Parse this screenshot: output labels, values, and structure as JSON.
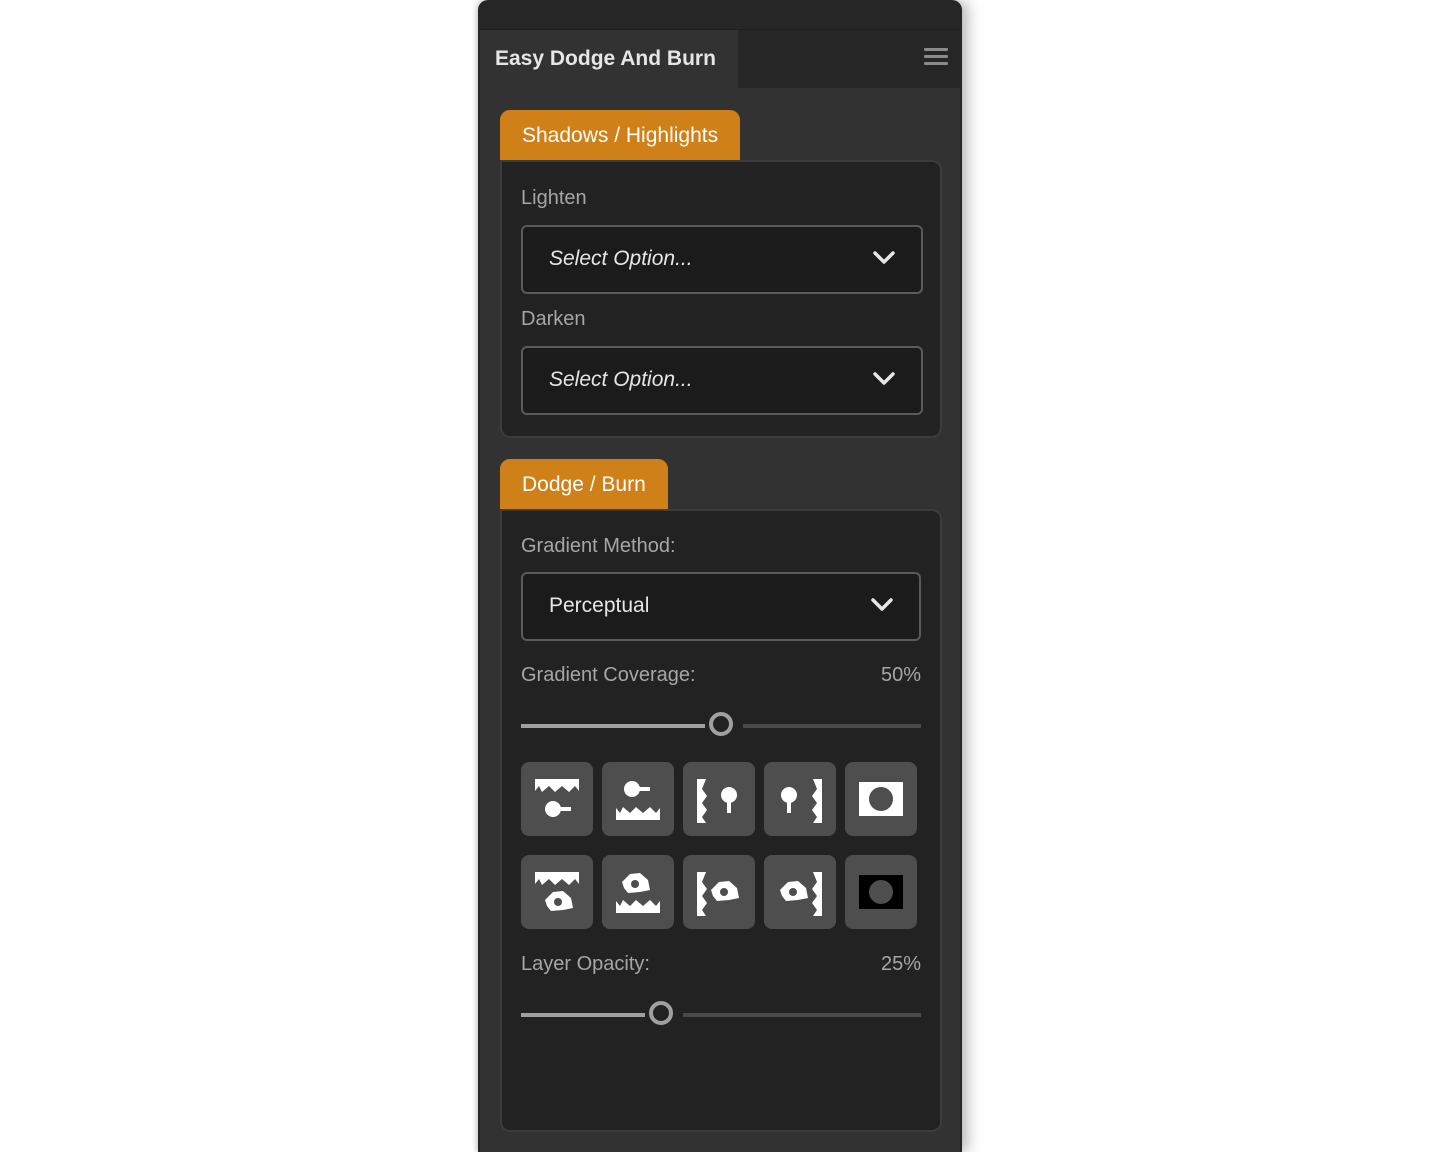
{
  "panel": {
    "title": "Easy Dodge And Burn",
    "menu_icon": "hamburger-menu-icon"
  },
  "shadows_highlights": {
    "tab_label": "Shadows / Highlights",
    "lighten": {
      "label": "Lighten",
      "value": "Select Option..."
    },
    "darken": {
      "label": "Darken",
      "value": "Select Option..."
    }
  },
  "dodge_burn": {
    "tab_label": "Dodge / Burn",
    "gradient_method": {
      "label": "Gradient Method:",
      "value": "Perceptual"
    },
    "gradient_coverage": {
      "label": "Gradient Coverage:",
      "value_text": "50%",
      "slider_fraction": 0.5
    },
    "gradient_buttons": [
      {
        "icon": "gradient-top-to-bottom-highlight-icon"
      },
      {
        "icon": "gradient-bottom-to-top-highlight-icon"
      },
      {
        "icon": "gradient-left-to-right-highlight-icon"
      },
      {
        "icon": "gradient-right-to-left-highlight-icon"
      },
      {
        "icon": "vignette-highlight-icon"
      },
      {
        "icon": "gradient-top-to-bottom-subject-icon"
      },
      {
        "icon": "gradient-bottom-to-top-subject-icon"
      },
      {
        "icon": "gradient-left-to-right-subject-icon"
      },
      {
        "icon": "gradient-right-to-left-subject-icon"
      },
      {
        "icon": "vignette-inverse-icon"
      }
    ],
    "layer_opacity": {
      "label": "Layer Opacity:",
      "value_text": "25%",
      "slider_fraction": 0.35
    }
  },
  "colors": {
    "accent": "#cf8018",
    "panel_bg": "#323232",
    "section_bg": "#222222"
  }
}
